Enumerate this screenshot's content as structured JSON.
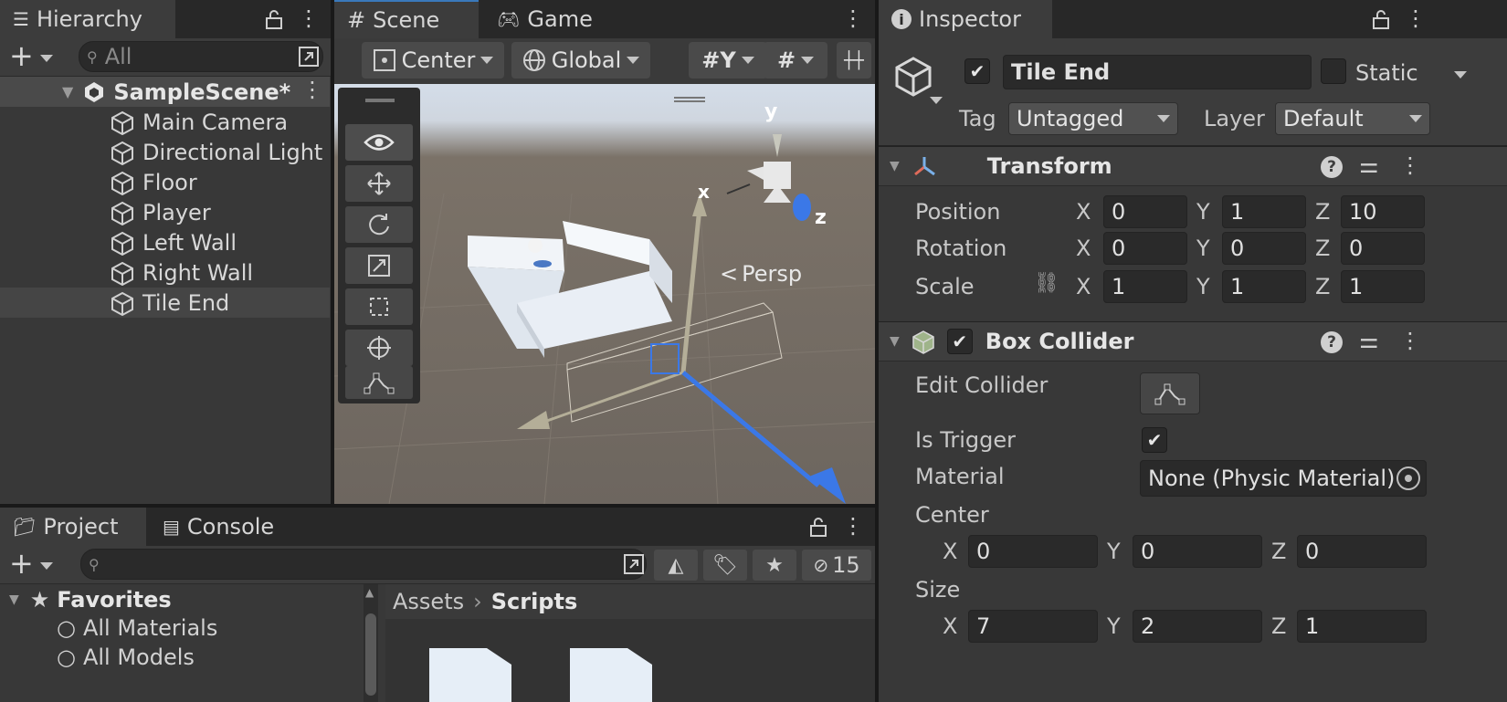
{
  "hierarchy": {
    "tab_label": "Hierarchy",
    "search_placeholder": "All",
    "scene_name": "SampleScene*",
    "items": [
      {
        "label": "Main Camera"
      },
      {
        "label": "Directional Light"
      },
      {
        "label": "Floor"
      },
      {
        "label": "Player"
      },
      {
        "label": "Left Wall"
      },
      {
        "label": "Right Wall"
      },
      {
        "label": "Tile End",
        "selected": true
      }
    ]
  },
  "scene_view": {
    "tabs": [
      "Scene",
      "Game"
    ],
    "pivot_mode": "Center",
    "pivot_rotation": "Global",
    "projection_label": "Persp",
    "axis_labels": {
      "x": "x",
      "y": "y",
      "z": "z"
    },
    "gizmo_x_label": "x",
    "tools": [
      "view-tool",
      "move-tool",
      "rotate-tool",
      "scale-tool",
      "rect-tool",
      "transform-tool",
      "edit-collider-tool"
    ]
  },
  "project": {
    "tabs": [
      "Project",
      "Console"
    ],
    "hidden_count": "15",
    "favorites_label": "Favorites",
    "favorites": [
      "All Materials",
      "All Models"
    ],
    "breadcrumb": [
      "Assets",
      "Scripts"
    ]
  },
  "inspector": {
    "tab_label": "Inspector",
    "object_name": "Tile End",
    "object_active": true,
    "static_label": "Static",
    "tag_label": "Tag",
    "tag_value": "Untagged",
    "layer_label": "Layer",
    "layer_value": "Default",
    "transform": {
      "title": "Transform",
      "rows": [
        {
          "label": "Position",
          "x": "0",
          "y": "1",
          "z": "10"
        },
        {
          "label": "Rotation",
          "x": "0",
          "y": "0",
          "z": "0"
        },
        {
          "label": "Scale",
          "x": "1",
          "y": "1",
          "z": "1"
        }
      ]
    },
    "box_collider": {
      "title": "Box Collider",
      "enabled": true,
      "edit_collider_label": "Edit Collider",
      "is_trigger_label": "Is Trigger",
      "is_trigger": true,
      "material_label": "Material",
      "material_value": "None (Physic Material)",
      "center_label": "Center",
      "center": {
        "x": "0",
        "y": "0",
        "z": "0"
      },
      "size_label": "Size",
      "size": {
        "x": "7",
        "y": "2",
        "z": "1"
      }
    },
    "axis": {
      "x": "X",
      "y": "Y",
      "z": "Z"
    }
  },
  "colors": {
    "accent": "#3a79bb",
    "z_axis": "#3b78e7",
    "panel": "#383838",
    "field": "#2a2a2a"
  }
}
